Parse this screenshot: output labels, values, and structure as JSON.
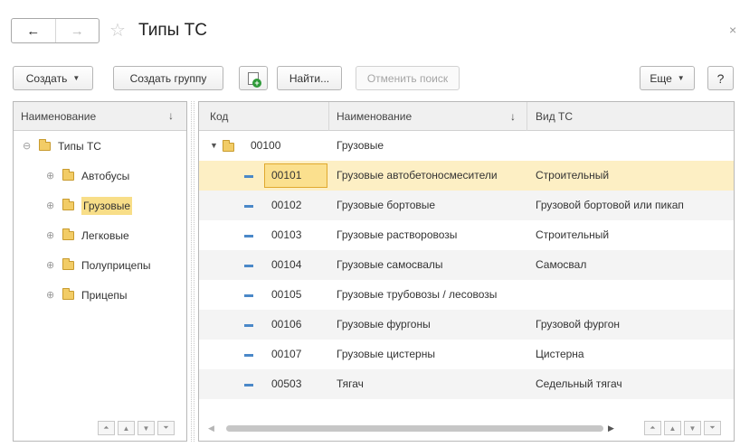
{
  "window": {
    "title": "Типы ТС"
  },
  "nav": {
    "back_icon": "←",
    "forward_icon": "→",
    "star_icon": "☆",
    "close_icon": "×"
  },
  "toolbar": {
    "create_label": "Создать",
    "create_group_label": "Создать группу",
    "find_label": "Найти...",
    "cancel_search_label": "Отменить поиск",
    "more_label": "Еще",
    "help_label": "?"
  },
  "tree": {
    "header": "Наименование",
    "sort_icon": "↓",
    "root": "Типы ТС",
    "items": [
      {
        "label": "Автобусы",
        "selected": false
      },
      {
        "label": "Грузовые",
        "selected": true
      },
      {
        "label": "Легковые",
        "selected": false
      },
      {
        "label": "Полуприцепы",
        "selected": false
      },
      {
        "label": "Прицепы",
        "selected": false
      }
    ]
  },
  "table": {
    "headers": {
      "code": "Код",
      "name": "Наименование",
      "name_sort_icon": "↓",
      "kind": "Вид ТС"
    },
    "group": {
      "code": "00100",
      "name": "Грузовые"
    },
    "rows": [
      {
        "code": "00101",
        "name": "Грузовые автобетоносмесители",
        "kind": "Строительный"
      },
      {
        "code": "00102",
        "name": "Грузовые бортовые",
        "kind": "Грузовой бортовой или пикап"
      },
      {
        "code": "00103",
        "name": "Грузовые растворовозы",
        "kind": "Строительный"
      },
      {
        "code": "00104",
        "name": "Грузовые самосвалы",
        "kind": "Самосвал"
      },
      {
        "code": "00105",
        "name": "Грузовые трубовозы / лесовозы",
        "kind": ""
      },
      {
        "code": "00106",
        "name": "Грузовые фургоны",
        "kind": "Грузовой фургон"
      },
      {
        "code": "00107",
        "name": "Грузовые цистерны",
        "kind": "Цистерна"
      },
      {
        "code": "00503",
        "name": "Тягач",
        "kind": "Седельный тягач"
      }
    ]
  },
  "colors": {
    "selection": "#fdefc4",
    "selected_cell": "#fbe08e",
    "folder": "#f2cc66",
    "item_icon": "#4a88c8"
  }
}
